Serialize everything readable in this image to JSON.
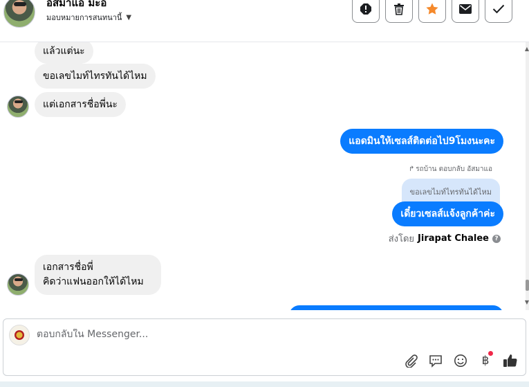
{
  "header": {
    "contact_name": "อัสมาแอ มะอิ",
    "assign_label": "มอบหมายการสนทนานี้",
    "actions": [
      {
        "name": "spam-button",
        "icon": "alert-icon"
      },
      {
        "name": "delete-button",
        "icon": "trash-icon"
      },
      {
        "name": "star-button",
        "icon": "star-icon"
      },
      {
        "name": "mark-unread-button",
        "icon": "envelope-icon"
      },
      {
        "name": "mark-done-button",
        "icon": "check-icon"
      }
    ],
    "star_color": "#f5892b"
  },
  "messages": {
    "incoming": [
      {
        "text": "แล้วแต่นะ"
      },
      {
        "text": "ขอเลขไมท์ไทรทันได้ไหม"
      },
      {
        "text": "แต่เอกสารชื่อพี่นะ"
      },
      {
        "text_line1": "เอกสารชื่อพี่",
        "text_line2": "คิดว่าแฟนออกให้ได้ไหม"
      }
    ],
    "outgoing": [
      {
        "text": "แอดมินให้เซลส์ติดต่อไป9โมงนะคะ"
      },
      {
        "text": "เดี๋ยวเซลส์แจ้งลูกค้าค่ะ"
      }
    ],
    "reply_meta": "รถบ้าน ตอบกลับ อัสมาแอ",
    "quoted_text": "ขอเลขไมท์ไทรทันได้ไหม",
    "sent_by_prefix": "ส่งโดย",
    "sent_by_name": "Jirapat Chalee",
    "outgoing_color": "#0a7cff"
  },
  "composer": {
    "placeholder": "ตอบกลับใน Messenger...",
    "icons": [
      "attachment-icon",
      "saved-reply-icon",
      "emoji-icon",
      "baht-payment-icon",
      "like-icon"
    ],
    "baht_symbol": "฿"
  }
}
